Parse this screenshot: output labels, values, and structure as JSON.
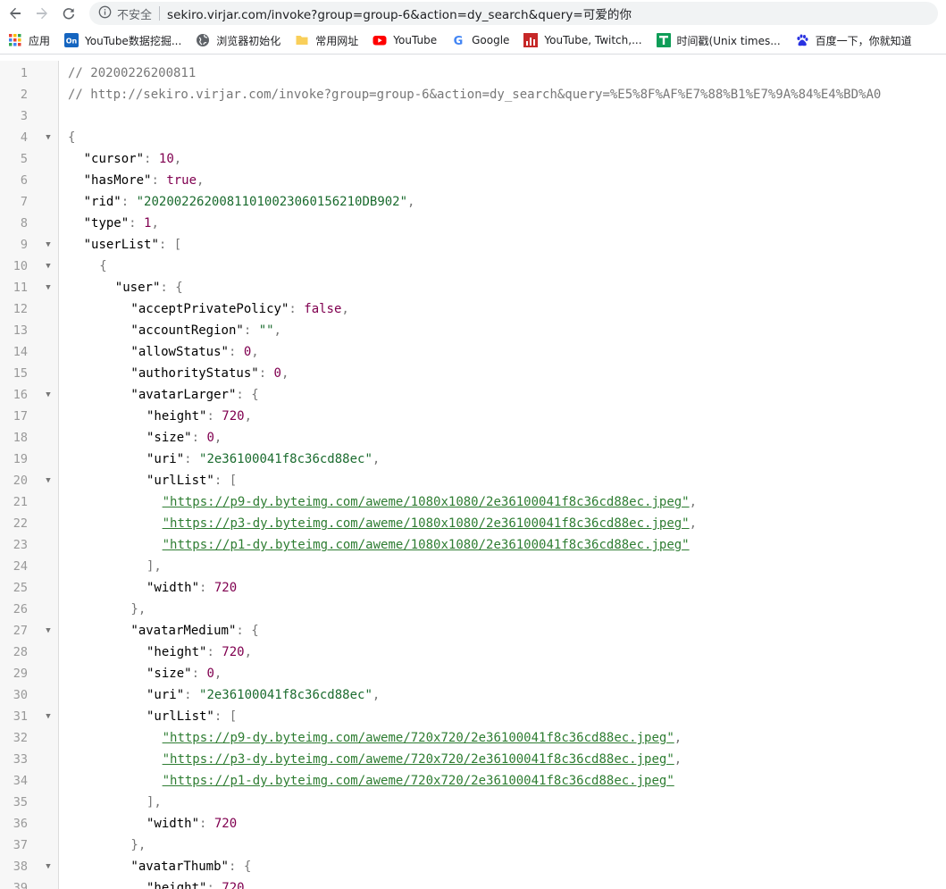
{
  "browser": {
    "insecure_label": "不安全",
    "url": "sekiro.virjar.com/invoke?group=group-6&action=dy_search&query=可爱的你"
  },
  "bookmarks": [
    {
      "label": "应用",
      "icon": "apps-grid-icon"
    },
    {
      "label": "YouTube数据挖掘...",
      "icon": "on-badge-icon"
    },
    {
      "label": "浏览器初始化",
      "icon": "globe-icon"
    },
    {
      "label": "常用网址",
      "icon": "folder-icon"
    },
    {
      "label": "YouTube",
      "icon": "youtube-icon"
    },
    {
      "label": "Google",
      "icon": "google-icon"
    },
    {
      "label": "YouTube, Twitch,...",
      "icon": "bar-chart-icon"
    },
    {
      "label": "时间戳(Unix times...",
      "icon": "t-badge-icon"
    },
    {
      "label": "百度一下，你就知道",
      "icon": "baidu-paw-icon"
    }
  ],
  "colors": {
    "string": "#1a6b2e",
    "number": "#800050",
    "link": "#2e7d32",
    "comment": "#777777"
  },
  "code_lines": [
    {
      "n": "1",
      "fold": false,
      "indent": 0,
      "tokens": [
        {
          "t": "// 20200226200811",
          "c": "comment"
        }
      ]
    },
    {
      "n": "2",
      "fold": false,
      "indent": 0,
      "tokens": [
        {
          "t": "// http://sekiro.virjar.com/invoke?group=group-6&action=dy_search&query=%E5%8F%AF%E7%88%B1%E7%9A%84%E4%BD%A0",
          "c": "comment"
        }
      ]
    },
    {
      "n": "3",
      "fold": false,
      "indent": 0,
      "tokens": []
    },
    {
      "n": "4",
      "fold": true,
      "indent": 0,
      "tokens": [
        {
          "t": "{",
          "c": "punc"
        }
      ]
    },
    {
      "n": "5",
      "fold": false,
      "indent": 1,
      "tokens": [
        {
          "t": "\"cursor\"",
          "c": "key"
        },
        {
          "t": ": ",
          "c": "punc"
        },
        {
          "t": "10",
          "c": "num"
        },
        {
          "t": ",",
          "c": "punc"
        }
      ]
    },
    {
      "n": "6",
      "fold": false,
      "indent": 1,
      "tokens": [
        {
          "t": "\"hasMore\"",
          "c": "key"
        },
        {
          "t": ": ",
          "c": "punc"
        },
        {
          "t": "true",
          "c": "bool"
        },
        {
          "t": ",",
          "c": "punc"
        }
      ]
    },
    {
      "n": "7",
      "fold": false,
      "indent": 1,
      "tokens": [
        {
          "t": "\"rid\"",
          "c": "key"
        },
        {
          "t": ": ",
          "c": "punc"
        },
        {
          "t": "\"20200226200811010023060156210DB902\"",
          "c": "str"
        },
        {
          "t": ",",
          "c": "punc"
        }
      ]
    },
    {
      "n": "8",
      "fold": false,
      "indent": 1,
      "tokens": [
        {
          "t": "\"type\"",
          "c": "key"
        },
        {
          "t": ": ",
          "c": "punc"
        },
        {
          "t": "1",
          "c": "num"
        },
        {
          "t": ",",
          "c": "punc"
        }
      ]
    },
    {
      "n": "9",
      "fold": true,
      "indent": 1,
      "tokens": [
        {
          "t": "\"userList\"",
          "c": "key"
        },
        {
          "t": ": [",
          "c": "punc"
        }
      ]
    },
    {
      "n": "10",
      "fold": true,
      "indent": 2,
      "tokens": [
        {
          "t": "{",
          "c": "punc"
        }
      ]
    },
    {
      "n": "11",
      "fold": true,
      "indent": 3,
      "tokens": [
        {
          "t": "\"user\"",
          "c": "key"
        },
        {
          "t": ": {",
          "c": "punc"
        }
      ]
    },
    {
      "n": "12",
      "fold": false,
      "indent": 4,
      "tokens": [
        {
          "t": "\"acceptPrivatePolicy\"",
          "c": "key"
        },
        {
          "t": ": ",
          "c": "punc"
        },
        {
          "t": "false",
          "c": "bool"
        },
        {
          "t": ",",
          "c": "punc"
        }
      ]
    },
    {
      "n": "13",
      "fold": false,
      "indent": 4,
      "tokens": [
        {
          "t": "\"accountRegion\"",
          "c": "key"
        },
        {
          "t": ": ",
          "c": "punc"
        },
        {
          "t": "\"\"",
          "c": "str"
        },
        {
          "t": ",",
          "c": "punc"
        }
      ]
    },
    {
      "n": "14",
      "fold": false,
      "indent": 4,
      "tokens": [
        {
          "t": "\"allowStatus\"",
          "c": "key"
        },
        {
          "t": ": ",
          "c": "punc"
        },
        {
          "t": "0",
          "c": "num"
        },
        {
          "t": ",",
          "c": "punc"
        }
      ]
    },
    {
      "n": "15",
      "fold": false,
      "indent": 4,
      "tokens": [
        {
          "t": "\"authorityStatus\"",
          "c": "key"
        },
        {
          "t": ": ",
          "c": "punc"
        },
        {
          "t": "0",
          "c": "num"
        },
        {
          "t": ",",
          "c": "punc"
        }
      ]
    },
    {
      "n": "16",
      "fold": true,
      "indent": 4,
      "tokens": [
        {
          "t": "\"avatarLarger\"",
          "c": "key"
        },
        {
          "t": ": {",
          "c": "punc"
        }
      ]
    },
    {
      "n": "17",
      "fold": false,
      "indent": 5,
      "tokens": [
        {
          "t": "\"height\"",
          "c": "key"
        },
        {
          "t": ": ",
          "c": "punc"
        },
        {
          "t": "720",
          "c": "num"
        },
        {
          "t": ",",
          "c": "punc"
        }
      ]
    },
    {
      "n": "18",
      "fold": false,
      "indent": 5,
      "tokens": [
        {
          "t": "\"size\"",
          "c": "key"
        },
        {
          "t": ": ",
          "c": "punc"
        },
        {
          "t": "0",
          "c": "num"
        },
        {
          "t": ",",
          "c": "punc"
        }
      ]
    },
    {
      "n": "19",
      "fold": false,
      "indent": 5,
      "tokens": [
        {
          "t": "\"uri\"",
          "c": "key"
        },
        {
          "t": ": ",
          "c": "punc"
        },
        {
          "t": "\"2e36100041f8c36cd88ec\"",
          "c": "str"
        },
        {
          "t": ",",
          "c": "punc"
        }
      ]
    },
    {
      "n": "20",
      "fold": true,
      "indent": 5,
      "tokens": [
        {
          "t": "\"urlList\"",
          "c": "key"
        },
        {
          "t": ": [",
          "c": "punc"
        }
      ]
    },
    {
      "n": "21",
      "fold": false,
      "indent": 6,
      "tokens": [
        {
          "t": "\"https://p9-dy.byteimg.com/aweme/1080x1080/2e36100041f8c36cd88ec.jpeg\"",
          "c": "link"
        },
        {
          "t": ",",
          "c": "punc"
        }
      ]
    },
    {
      "n": "22",
      "fold": false,
      "indent": 6,
      "tokens": [
        {
          "t": "\"https://p3-dy.byteimg.com/aweme/1080x1080/2e36100041f8c36cd88ec.jpeg\"",
          "c": "link"
        },
        {
          "t": ",",
          "c": "punc"
        }
      ]
    },
    {
      "n": "23",
      "fold": false,
      "indent": 6,
      "tokens": [
        {
          "t": "\"https://p1-dy.byteimg.com/aweme/1080x1080/2e36100041f8c36cd88ec.jpeg\"",
          "c": "link"
        }
      ]
    },
    {
      "n": "24",
      "fold": false,
      "indent": 5,
      "tokens": [
        {
          "t": "],",
          "c": "punc"
        }
      ]
    },
    {
      "n": "25",
      "fold": false,
      "indent": 5,
      "tokens": [
        {
          "t": "\"width\"",
          "c": "key"
        },
        {
          "t": ": ",
          "c": "punc"
        },
        {
          "t": "720",
          "c": "num"
        }
      ]
    },
    {
      "n": "26",
      "fold": false,
      "indent": 4,
      "tokens": [
        {
          "t": "},",
          "c": "punc"
        }
      ]
    },
    {
      "n": "27",
      "fold": true,
      "indent": 4,
      "tokens": [
        {
          "t": "\"avatarMedium\"",
          "c": "key"
        },
        {
          "t": ": {",
          "c": "punc"
        }
      ]
    },
    {
      "n": "28",
      "fold": false,
      "indent": 5,
      "tokens": [
        {
          "t": "\"height\"",
          "c": "key"
        },
        {
          "t": ": ",
          "c": "punc"
        },
        {
          "t": "720",
          "c": "num"
        },
        {
          "t": ",",
          "c": "punc"
        }
      ]
    },
    {
      "n": "29",
      "fold": false,
      "indent": 5,
      "tokens": [
        {
          "t": "\"size\"",
          "c": "key"
        },
        {
          "t": ": ",
          "c": "punc"
        },
        {
          "t": "0",
          "c": "num"
        },
        {
          "t": ",",
          "c": "punc"
        }
      ]
    },
    {
      "n": "30",
      "fold": false,
      "indent": 5,
      "tokens": [
        {
          "t": "\"uri\"",
          "c": "key"
        },
        {
          "t": ": ",
          "c": "punc"
        },
        {
          "t": "\"2e36100041f8c36cd88ec\"",
          "c": "str"
        },
        {
          "t": ",",
          "c": "punc"
        }
      ]
    },
    {
      "n": "31",
      "fold": true,
      "indent": 5,
      "tokens": [
        {
          "t": "\"urlList\"",
          "c": "key"
        },
        {
          "t": ": [",
          "c": "punc"
        }
      ]
    },
    {
      "n": "32",
      "fold": false,
      "indent": 6,
      "tokens": [
        {
          "t": "\"https://p9-dy.byteimg.com/aweme/720x720/2e36100041f8c36cd88ec.jpeg\"",
          "c": "link"
        },
        {
          "t": ",",
          "c": "punc"
        }
      ]
    },
    {
      "n": "33",
      "fold": false,
      "indent": 6,
      "tokens": [
        {
          "t": "\"https://p3-dy.byteimg.com/aweme/720x720/2e36100041f8c36cd88ec.jpeg\"",
          "c": "link"
        },
        {
          "t": ",",
          "c": "punc"
        }
      ]
    },
    {
      "n": "34",
      "fold": false,
      "indent": 6,
      "tokens": [
        {
          "t": "\"https://p1-dy.byteimg.com/aweme/720x720/2e36100041f8c36cd88ec.jpeg\"",
          "c": "link"
        }
      ]
    },
    {
      "n": "35",
      "fold": false,
      "indent": 5,
      "tokens": [
        {
          "t": "],",
          "c": "punc"
        }
      ]
    },
    {
      "n": "36",
      "fold": false,
      "indent": 5,
      "tokens": [
        {
          "t": "\"width\"",
          "c": "key"
        },
        {
          "t": ": ",
          "c": "punc"
        },
        {
          "t": "720",
          "c": "num"
        }
      ]
    },
    {
      "n": "37",
      "fold": false,
      "indent": 4,
      "tokens": [
        {
          "t": "},",
          "c": "punc"
        }
      ]
    },
    {
      "n": "38",
      "fold": true,
      "indent": 4,
      "tokens": [
        {
          "t": "\"avatarThumb\"",
          "c": "key"
        },
        {
          "t": ": {",
          "c": "punc"
        }
      ]
    },
    {
      "n": "39",
      "fold": false,
      "indent": 5,
      "tokens": [
        {
          "t": "\"height\"",
          "c": "key"
        },
        {
          "t": ": ",
          "c": "punc"
        },
        {
          "t": "720",
          "c": "num"
        }
      ]
    }
  ]
}
